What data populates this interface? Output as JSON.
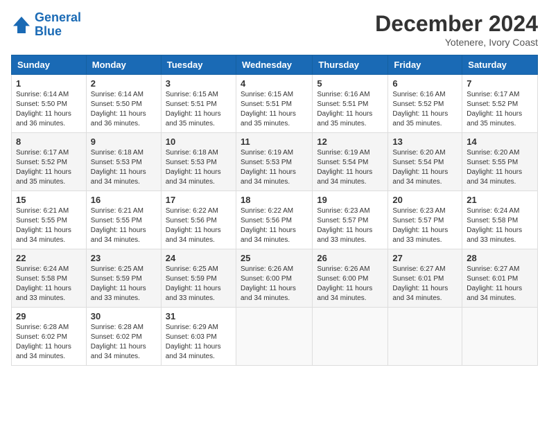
{
  "header": {
    "logo_line1": "General",
    "logo_line2": "Blue",
    "month": "December 2024",
    "location": "Yotenere, Ivory Coast"
  },
  "days_of_week": [
    "Sunday",
    "Monday",
    "Tuesday",
    "Wednesday",
    "Thursday",
    "Friday",
    "Saturday"
  ],
  "weeks": [
    [
      {
        "day": "1",
        "info": "Sunrise: 6:14 AM\nSunset: 5:50 PM\nDaylight: 11 hours\nand 36 minutes."
      },
      {
        "day": "2",
        "info": "Sunrise: 6:14 AM\nSunset: 5:50 PM\nDaylight: 11 hours\nand 36 minutes."
      },
      {
        "day": "3",
        "info": "Sunrise: 6:15 AM\nSunset: 5:51 PM\nDaylight: 11 hours\nand 35 minutes."
      },
      {
        "day": "4",
        "info": "Sunrise: 6:15 AM\nSunset: 5:51 PM\nDaylight: 11 hours\nand 35 minutes."
      },
      {
        "day": "5",
        "info": "Sunrise: 6:16 AM\nSunset: 5:51 PM\nDaylight: 11 hours\nand 35 minutes."
      },
      {
        "day": "6",
        "info": "Sunrise: 6:16 AM\nSunset: 5:52 PM\nDaylight: 11 hours\nand 35 minutes."
      },
      {
        "day": "7",
        "info": "Sunrise: 6:17 AM\nSunset: 5:52 PM\nDaylight: 11 hours\nand 35 minutes."
      }
    ],
    [
      {
        "day": "8",
        "info": "Sunrise: 6:17 AM\nSunset: 5:52 PM\nDaylight: 11 hours\nand 35 minutes."
      },
      {
        "day": "9",
        "info": "Sunrise: 6:18 AM\nSunset: 5:53 PM\nDaylight: 11 hours\nand 34 minutes."
      },
      {
        "day": "10",
        "info": "Sunrise: 6:18 AM\nSunset: 5:53 PM\nDaylight: 11 hours\nand 34 minutes."
      },
      {
        "day": "11",
        "info": "Sunrise: 6:19 AM\nSunset: 5:53 PM\nDaylight: 11 hours\nand 34 minutes."
      },
      {
        "day": "12",
        "info": "Sunrise: 6:19 AM\nSunset: 5:54 PM\nDaylight: 11 hours\nand 34 minutes."
      },
      {
        "day": "13",
        "info": "Sunrise: 6:20 AM\nSunset: 5:54 PM\nDaylight: 11 hours\nand 34 minutes."
      },
      {
        "day": "14",
        "info": "Sunrise: 6:20 AM\nSunset: 5:55 PM\nDaylight: 11 hours\nand 34 minutes."
      }
    ],
    [
      {
        "day": "15",
        "info": "Sunrise: 6:21 AM\nSunset: 5:55 PM\nDaylight: 11 hours\nand 34 minutes."
      },
      {
        "day": "16",
        "info": "Sunrise: 6:21 AM\nSunset: 5:55 PM\nDaylight: 11 hours\nand 34 minutes."
      },
      {
        "day": "17",
        "info": "Sunrise: 6:22 AM\nSunset: 5:56 PM\nDaylight: 11 hours\nand 34 minutes."
      },
      {
        "day": "18",
        "info": "Sunrise: 6:22 AM\nSunset: 5:56 PM\nDaylight: 11 hours\nand 34 minutes."
      },
      {
        "day": "19",
        "info": "Sunrise: 6:23 AM\nSunset: 5:57 PM\nDaylight: 11 hours\nand 33 minutes."
      },
      {
        "day": "20",
        "info": "Sunrise: 6:23 AM\nSunset: 5:57 PM\nDaylight: 11 hours\nand 33 minutes."
      },
      {
        "day": "21",
        "info": "Sunrise: 6:24 AM\nSunset: 5:58 PM\nDaylight: 11 hours\nand 33 minutes."
      }
    ],
    [
      {
        "day": "22",
        "info": "Sunrise: 6:24 AM\nSunset: 5:58 PM\nDaylight: 11 hours\nand 33 minutes."
      },
      {
        "day": "23",
        "info": "Sunrise: 6:25 AM\nSunset: 5:59 PM\nDaylight: 11 hours\nand 33 minutes."
      },
      {
        "day": "24",
        "info": "Sunrise: 6:25 AM\nSunset: 5:59 PM\nDaylight: 11 hours\nand 33 minutes."
      },
      {
        "day": "25",
        "info": "Sunrise: 6:26 AM\nSunset: 6:00 PM\nDaylight: 11 hours\nand 34 minutes."
      },
      {
        "day": "26",
        "info": "Sunrise: 6:26 AM\nSunset: 6:00 PM\nDaylight: 11 hours\nand 34 minutes."
      },
      {
        "day": "27",
        "info": "Sunrise: 6:27 AM\nSunset: 6:01 PM\nDaylight: 11 hours\nand 34 minutes."
      },
      {
        "day": "28",
        "info": "Sunrise: 6:27 AM\nSunset: 6:01 PM\nDaylight: 11 hours\nand 34 minutes."
      }
    ],
    [
      {
        "day": "29",
        "info": "Sunrise: 6:28 AM\nSunset: 6:02 PM\nDaylight: 11 hours\nand 34 minutes."
      },
      {
        "day": "30",
        "info": "Sunrise: 6:28 AM\nSunset: 6:02 PM\nDaylight: 11 hours\nand 34 minutes."
      },
      {
        "day": "31",
        "info": "Sunrise: 6:29 AM\nSunset: 6:03 PM\nDaylight: 11 hours\nand 34 minutes."
      },
      {
        "day": "",
        "info": ""
      },
      {
        "day": "",
        "info": ""
      },
      {
        "day": "",
        "info": ""
      },
      {
        "day": "",
        "info": ""
      }
    ]
  ]
}
